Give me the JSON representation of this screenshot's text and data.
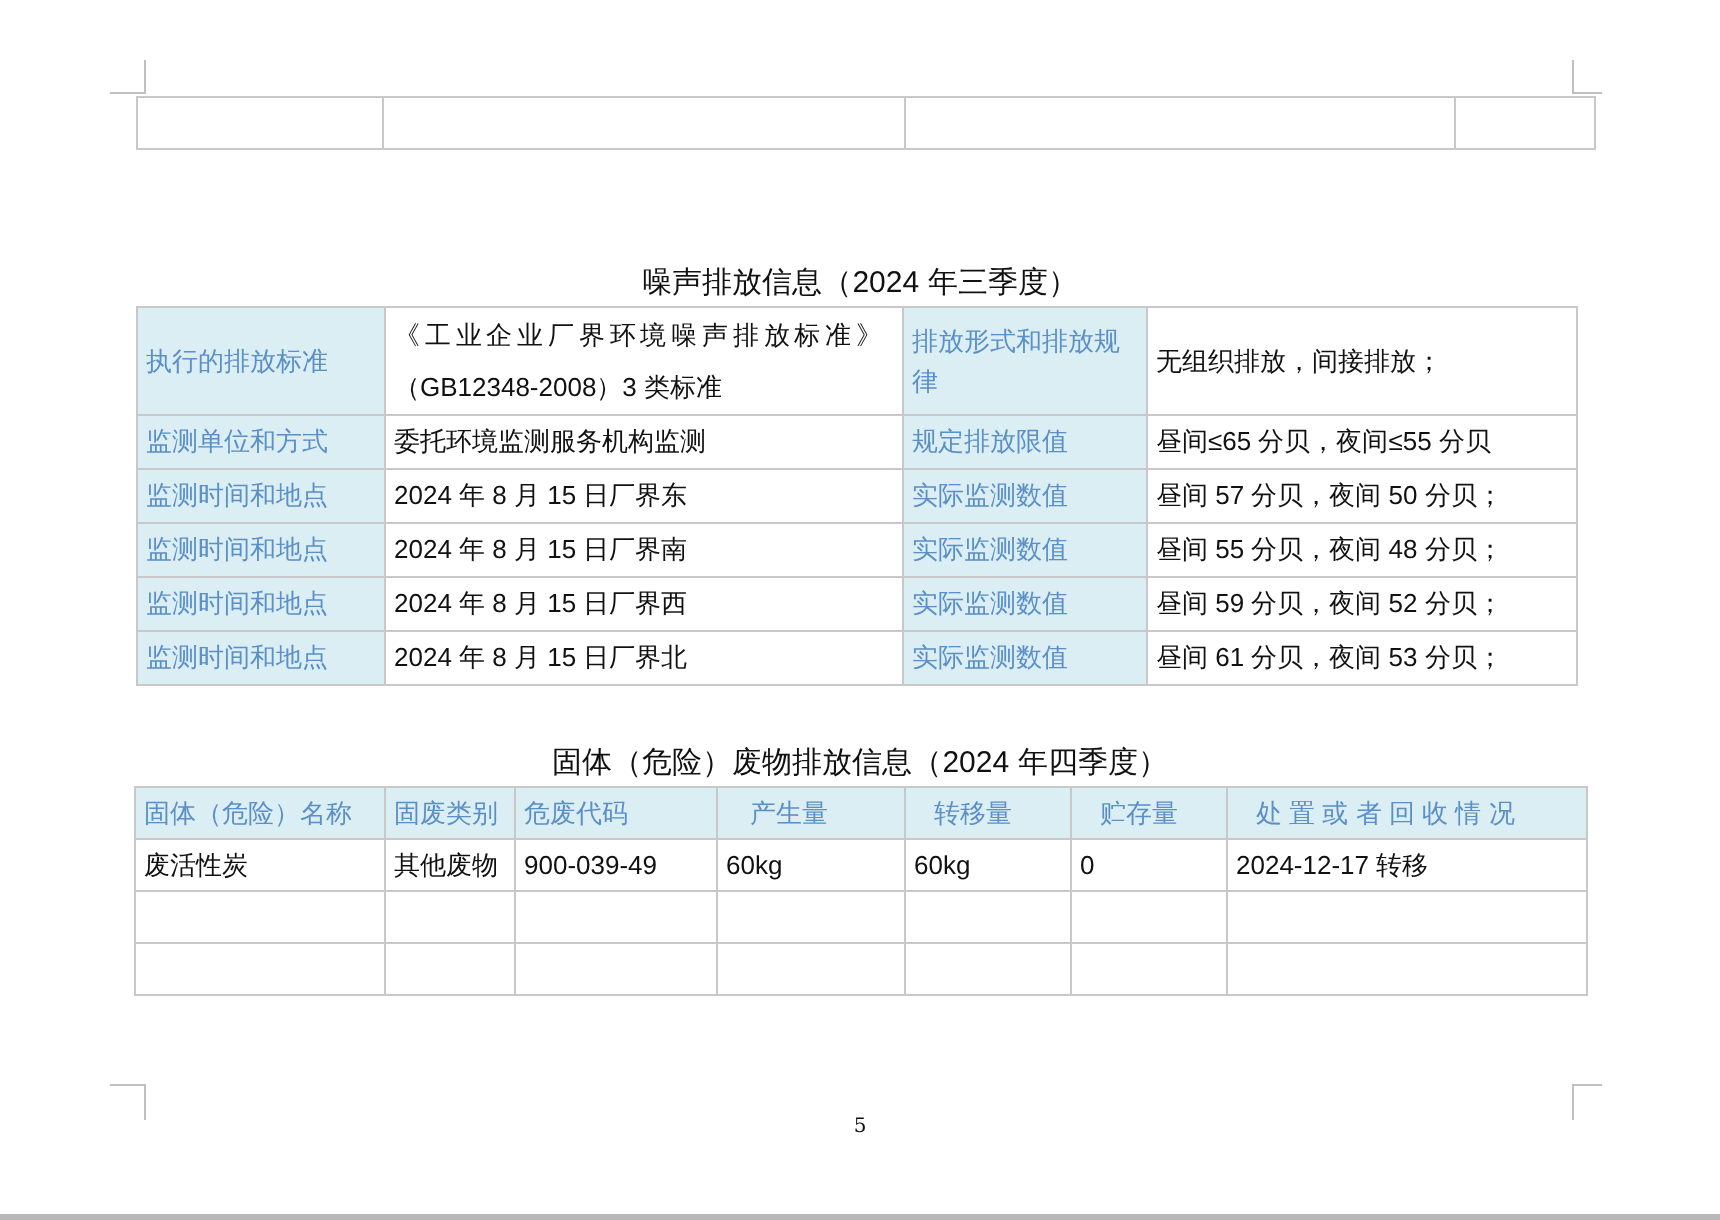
{
  "noise_section": {
    "title": "噪声排放信息（2024 年三季度）",
    "rows": [
      {
        "label": "执行的排放标准",
        "value_lines": [
          "《工业企业厂界环境噪声排放标准》",
          "（GB12348-2008）3 类标准"
        ],
        "label_2": "排放形式和排放规律",
        "value_2": "无组织排放，间接排放；"
      },
      {
        "label": "监测单位和方式",
        "value_lines": [
          "委托环境监测服务机构监测"
        ],
        "label_2": "规定排放限值",
        "value_2": "昼间≤65 分贝，夜间≤55 分贝"
      },
      {
        "label": "监测时间和地点",
        "value_lines": [
          "2024 年 8 月 15 日厂界东"
        ],
        "label_2": "实际监测数值",
        "value_2": "昼间 57 分贝，夜间 50 分贝；"
      },
      {
        "label": "监测时间和地点",
        "value_lines": [
          "2024 年 8 月 15 日厂界南"
        ],
        "label_2": "实际监测数值",
        "value_2": "昼间 55 分贝，夜间 48 分贝；"
      },
      {
        "label": "监测时间和地点",
        "value_lines": [
          "2024 年 8 月 15 日厂界西"
        ],
        "label_2": "实际监测数值",
        "value_2": "昼间 59 分贝，夜间 52 分贝；"
      },
      {
        "label": "监测时间和地点",
        "value_lines": [
          "2024 年 8 月 15 日厂界北"
        ],
        "label_2": "实际监测数值",
        "value_2": "昼间 61 分贝，夜间 53 分贝；"
      }
    ]
  },
  "waste_section": {
    "title": "固体（危险）废物排放信息（2024 年四季度）",
    "columns": [
      "固体（危险）名称",
      "固废类别",
      "危废代码",
      "产生量",
      "转移量",
      "贮存量",
      "处 置 或 者 回 收 情 况"
    ],
    "rows": [
      [
        "废活性炭",
        "其他废物",
        "900-039-49",
        "60kg",
        "60kg",
        "0",
        "2024-12-17 转移"
      ]
    ]
  },
  "page_number": "5"
}
